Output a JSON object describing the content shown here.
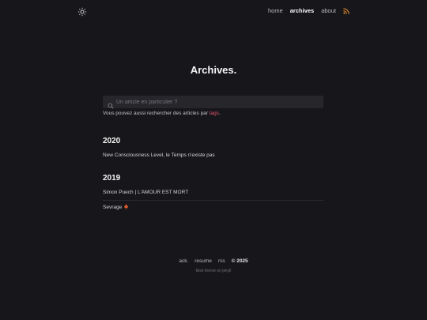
{
  "nav": {
    "items": [
      {
        "label": "home",
        "active": false
      },
      {
        "label": "archives",
        "active": true
      },
      {
        "label": "about",
        "active": false
      }
    ]
  },
  "page": {
    "title": "Archives."
  },
  "search": {
    "placeholder": "Un article en particulier ?",
    "value": ""
  },
  "hint": {
    "text": "Vous pouvez aussi rechercher des articles par ",
    "link": "tags",
    "end": "."
  },
  "archives": [
    {
      "year": "2020",
      "posts": [
        "New Consciousness Level, le Temps n'existe pas"
      ]
    },
    {
      "year": "2019",
      "posts": [
        "Simon Puech | L'AMOUR EST MORT",
        "Sevrage"
      ]
    }
  ],
  "footer": {
    "links": [
      "ack.",
      "resume",
      "rss"
    ],
    "copyright": "© 2025",
    "credit": "klisé theme on jekyll"
  },
  "colors": {
    "background": "#17171b",
    "accent": "#e05470",
    "rss": "#e08a2e"
  }
}
